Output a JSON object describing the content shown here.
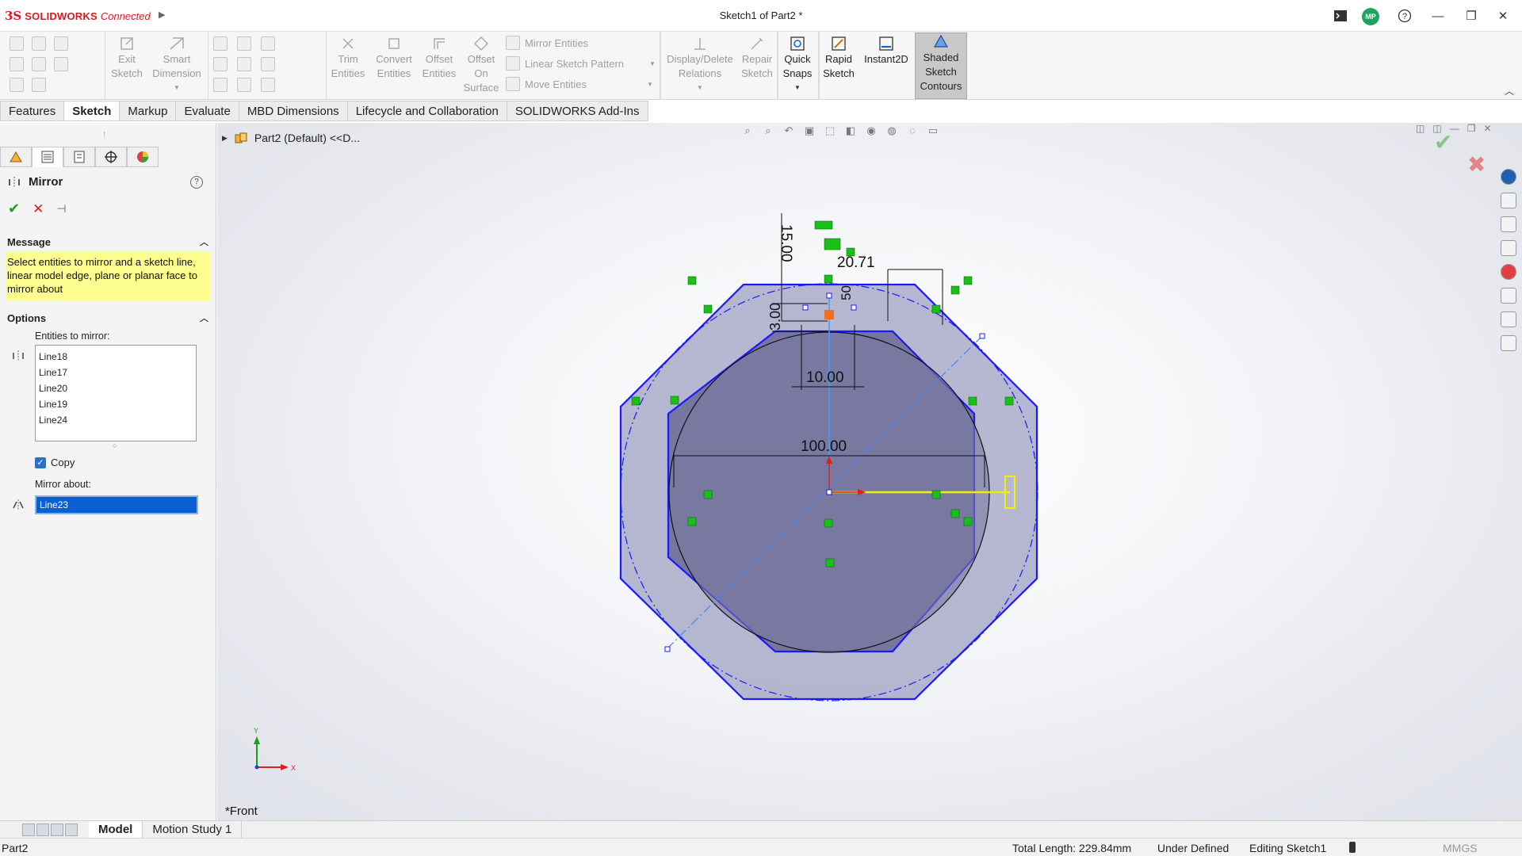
{
  "titlebar": {
    "logo_ds": "3S",
    "logo_brand": "SOLIDWORKS",
    "logo_connected": "Connected",
    "doc_title": "Sketch1 of Part2 *",
    "avatar": "MP"
  },
  "ribbon": {
    "exit_sketch": [
      "Exit",
      "Sketch"
    ],
    "smart_dimension": [
      "Smart",
      "Dimension"
    ],
    "trim_entities": [
      "Trim",
      "Entities"
    ],
    "convert_entities": [
      "Convert",
      "Entities"
    ],
    "offset_entities": [
      "Offset",
      "Entities"
    ],
    "offset_on_surface": [
      "Offset",
      "On",
      "Surface"
    ],
    "mirror_entities": "Mirror Entities",
    "linear_sketch_pattern": "Linear Sketch Pattern",
    "move_entities": "Move Entities",
    "display_delete_relations": [
      "Display/Delete",
      "Relations"
    ],
    "repair_sketch": [
      "Repair",
      "Sketch"
    ],
    "quick_snaps": [
      "Quick",
      "Snaps"
    ],
    "rapid_sketch": [
      "Rapid",
      "Sketch"
    ],
    "instant2d": "Instant2D",
    "shaded_sketch_contours": [
      "Shaded",
      "Sketch",
      "Contours"
    ]
  },
  "command_tabs": [
    "Features",
    "Sketch",
    "Markup",
    "Evaluate",
    "MBD Dimensions",
    "Lifecycle and Collaboration",
    "SOLIDWORKS Add-Ins"
  ],
  "active_command_tab": "Sketch",
  "property_manager": {
    "title": "Mirror",
    "help": "?",
    "message_header": "Message",
    "message_text": "Select entities to mirror and a sketch line, linear model edge, plane or planar face to mirror about",
    "options_header": "Options",
    "entities_label": "Entities to mirror:",
    "entities": [
      "Line18",
      "Line17",
      "Line20",
      "Line19",
      "Line24"
    ],
    "copy_label": "Copy",
    "copy_checked": true,
    "mirror_about_label": "Mirror about:",
    "mirror_about_value": "Line23"
  },
  "graphics": {
    "tree_item": "Part2 (Default) <<D...",
    "view_name": "*Front",
    "triad_x": "X",
    "triad_y": "Y",
    "dimensions": {
      "d15": "15.00",
      "d2071": "20.71",
      "d50": "50",
      "d300": "3.00",
      "d1000": "10.00",
      "d10000": "100.00"
    }
  },
  "bottom_tabs": [
    "Model",
    "Motion Study 1"
  ],
  "active_bottom_tab": "Model",
  "status": {
    "doc": "Part2",
    "total_length": "Total Length: 229.84mm",
    "state": "Under Defined",
    "editing": "Editing Sketch1",
    "units": "MMGS"
  },
  "colors": {
    "brand_red": "#d71920",
    "sketch_blue": "#1a1aff",
    "relation_green": "#18c018",
    "selection_yellow": "#f0f000",
    "message_yellow": "#fdfd8f"
  }
}
